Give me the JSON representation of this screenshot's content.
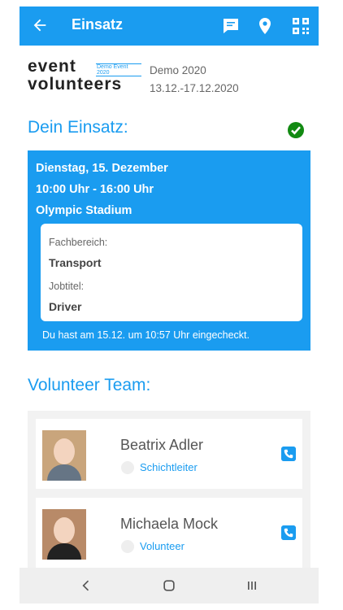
{
  "appbar": {
    "title": "Einsatz",
    "back_icon": "arrow-left-icon",
    "chat_icon": "chat-bubble-icon",
    "location_icon": "map-pin-icon",
    "qr_icon": "qr-code-icon"
  },
  "event": {
    "logo_text_line1": "event",
    "logo_text_line2": "volunteers",
    "logo_tag": "Demo Event 2020",
    "name": "Demo 2020",
    "dates": "13.12.-17.12.2020"
  },
  "section_einsatz": {
    "title": "Dein Einsatz:",
    "status_icon": "check-circle-icon"
  },
  "assignment": {
    "date": "Dienstag, 15. Dezember",
    "time": "10:00 Uhr - 16:00 Uhr",
    "location": "Olympic Stadium",
    "fachbereich_label": "Fachbereich:",
    "fachbereich_value": "Transport",
    "jobtitel_label": "Jobtitel:",
    "jobtitel_value": "Driver",
    "checkin_text": "Du hast am 15.12. um 10:57 Uhr eingecheckt."
  },
  "section_team": {
    "title": "Volunteer Team:"
  },
  "team": [
    {
      "name": "Beatrix Adler",
      "role": "Schichtleiter",
      "phone_icon": "phone-icon"
    },
    {
      "name": "Michaela Mock",
      "role": "Volunteer",
      "phone_icon": "phone-icon"
    }
  ],
  "navbar": {
    "back_icon": "nav-back-icon",
    "home_icon": "nav-home-icon",
    "recent_icon": "nav-recent-icon"
  },
  "colors": {
    "primary": "#1a9cf0",
    "success": "#128a12"
  }
}
